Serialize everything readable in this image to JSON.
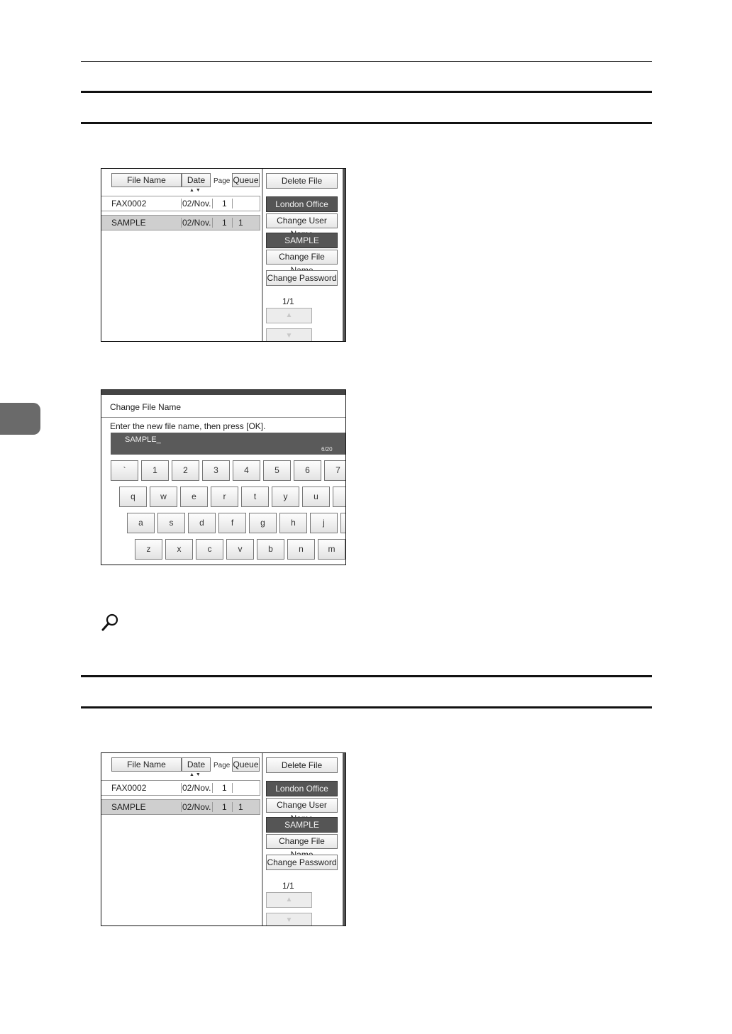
{
  "screens": [
    {
      "header": {
        "file_name": "File Name",
        "date": "Date",
        "page": "Page",
        "queue": "Queue",
        "sort_arrows": "▲▼"
      },
      "rows": [
        {
          "name": "FAX0002",
          "date": "02/Nov.",
          "page": "1",
          "queue": "",
          "selected": false
        },
        {
          "name": "SAMPLE",
          "date": "02/Nov.",
          "page": "1",
          "queue": "1",
          "selected": true
        }
      ],
      "buttons": {
        "delete_file": "Delete File",
        "user_name": "London Office",
        "change_user_name": "Change User Name",
        "file_name": "SAMPLE",
        "change_file_name": "Change File Name",
        "change_password": "Change Password"
      },
      "pager": "1/1",
      "arrow_up": "▲",
      "arrow_down": "▼"
    },
    {
      "header": {
        "file_name": "File Name",
        "date": "Date",
        "page": "Page",
        "queue": "Queue",
        "sort_arrows": "▲▼"
      },
      "rows": [
        {
          "name": "FAX0002",
          "date": "02/Nov.",
          "page": "1",
          "queue": "",
          "selected": false
        },
        {
          "name": "SAMPLE",
          "date": "02/Nov.",
          "page": "1",
          "queue": "1",
          "selected": true
        }
      ],
      "buttons": {
        "delete_file": "Delete File",
        "user_name": "London Office",
        "change_user_name": "Change User Name",
        "file_name": "SAMPLE",
        "change_file_name": "Change File Name",
        "change_password": "Change Password"
      },
      "pager": "1/1",
      "arrow_up": "▲",
      "arrow_down": "▼"
    }
  ],
  "keyboard": {
    "title": "Change File Name",
    "prompt": "Enter the new file name, then press [OK].",
    "value": "SAMPLE_",
    "counter": "6/20",
    "rows": [
      [
        "`",
        "1",
        "2",
        "3",
        "4",
        "5",
        "6",
        "7"
      ],
      [
        "q",
        "w",
        "e",
        "r",
        "t",
        "y",
        "u",
        ""
      ],
      [
        "a",
        "s",
        "d",
        "f",
        "g",
        "h",
        "j",
        ""
      ],
      [
        "z",
        "x",
        "c",
        "v",
        "b",
        "n",
        "m"
      ]
    ]
  }
}
